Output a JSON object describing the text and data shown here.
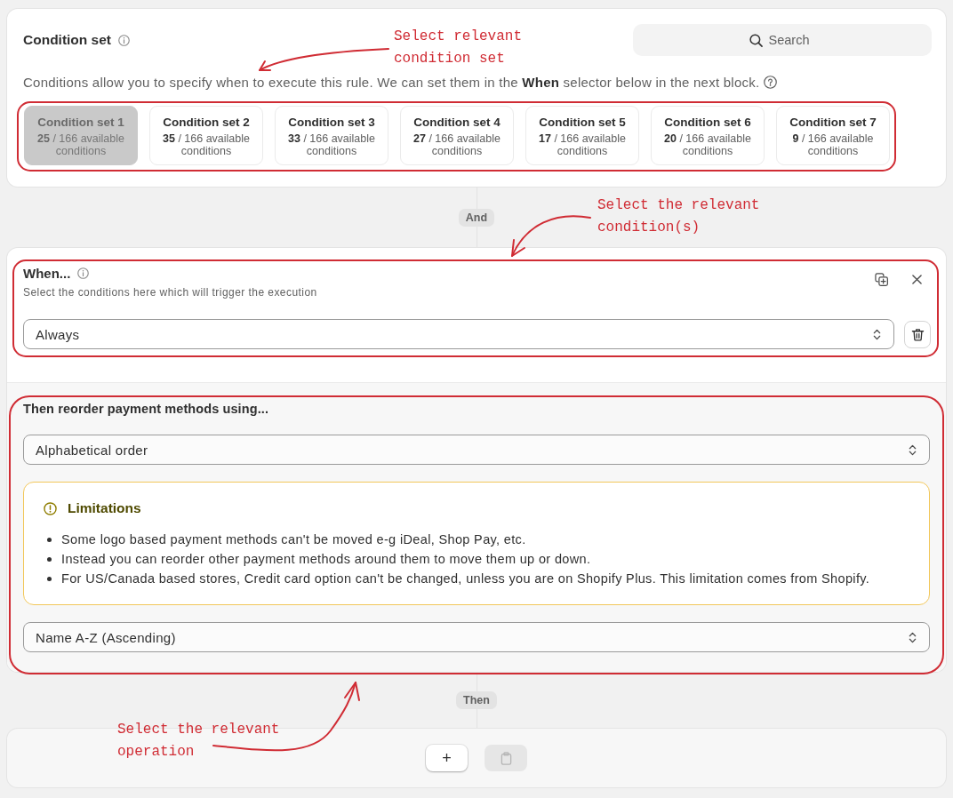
{
  "condition_set": {
    "title": "Condition set",
    "search": {
      "placeholder": "Search"
    },
    "description": "Conditions allow you to specify when to execute this rule. We can set them in the **When** selector below in the next block.",
    "sets": [
      {
        "name": "Condition set 1",
        "count": "**25** / 166 available conditions",
        "selected": true
      },
      {
        "name": "Condition set 2",
        "count": "**35** / 166 available conditions",
        "selected": false
      },
      {
        "name": "Condition set 3",
        "count": "**33** / 166 available conditions",
        "selected": false
      },
      {
        "name": "Condition set 4",
        "count": "**27** / 166 available conditions",
        "selected": false
      },
      {
        "name": "Condition set 5",
        "count": "**17** / 166 available conditions",
        "selected": false
      },
      {
        "name": "Condition set 6",
        "count": "**20** / 166 available conditions",
        "selected": false
      },
      {
        "name": "Condition set 7",
        "count": "**9** / 166 available conditions",
        "selected": false
      }
    ]
  },
  "connector_1": {
    "label": "And"
  },
  "when": {
    "title": "When...",
    "subtitle": "Select the conditions here which will trigger the execution",
    "select": {
      "value": "Always"
    }
  },
  "then": {
    "title": "Then reorder payment methods using...",
    "method_select": {
      "value": "Alphabetical order"
    },
    "limitations": {
      "title": "Limitations",
      "items": [
        "Some logo based payment methods can't be moved e-g iDeal, Shop Pay, etc.",
        "Instead you can reorder other payment methods around them to move them up or down.",
        "For US/Canada based stores, Credit card option can't be changed, unless you are on Shopify Plus. This limitation comes from Shopify."
      ]
    },
    "order_select": {
      "value": "Name A-Z (Ascending)"
    }
  },
  "connector_2": {
    "label": "Then"
  },
  "operation": {
    "add_button": "+",
    "paste_button": {
      "disabled": true
    }
  },
  "annotations": [
    {
      "text": "Select relevant\ncondition set"
    },
    {
      "text": "Select the relevant\ncondition(s)"
    },
    {
      "text": "Select the relevant\noperation"
    }
  ]
}
